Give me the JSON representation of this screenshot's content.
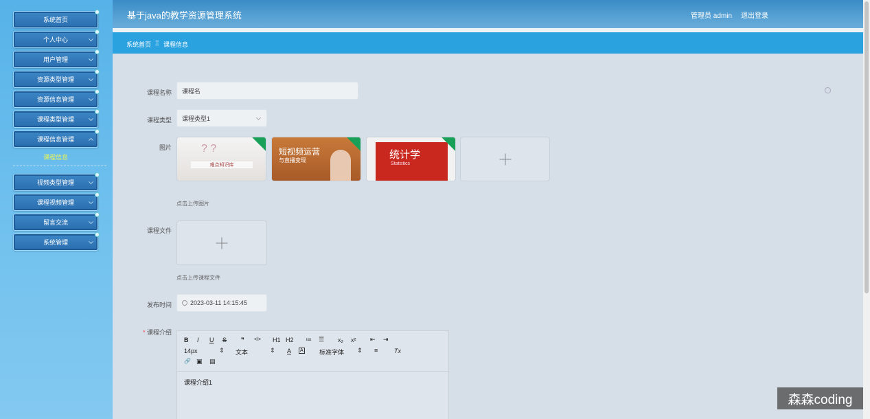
{
  "app": {
    "title": "基于java的教学资源管理系统",
    "user_label": "管理员 admin",
    "logout_label": "退出登录"
  },
  "sidebar": {
    "items": [
      {
        "label": "系统首页"
      },
      {
        "label": "个人中心"
      },
      {
        "label": "用户管理"
      },
      {
        "label": "资源类型管理"
      },
      {
        "label": "资源信息管理"
      },
      {
        "label": "课程类型管理"
      },
      {
        "label": "课程信息管理"
      },
      {
        "label": "视频类型管理"
      },
      {
        "label": "课程视频管理"
      },
      {
        "label": "留言交流"
      },
      {
        "label": "系统管理"
      }
    ],
    "active_sub_item": "课程信息"
  },
  "breadcrumb": {
    "home": "系统首页",
    "separator": "Ξ",
    "current": "课程信息"
  },
  "form": {
    "course_name_label": "课程名称",
    "course_name_value": "课程名",
    "course_type_label": "课程类型",
    "course_type_value": "课程类型1",
    "image_label": "图片",
    "image_hint": "点击上传图片",
    "images": [
      {
        "caption": "难点知识库"
      },
      {
        "title": "短视频运营",
        "subtitle": "与直播变现"
      },
      {
        "title": "统计学",
        "subtitle": "Statistics"
      }
    ],
    "file_label": "课程文件",
    "file_hint": "点击上传课程文件",
    "publish_time_label": "发布时间",
    "publish_time_value": "2023-03-11 14:15:45",
    "intro_required_mark": "*",
    "intro_label": "课程介绍",
    "intro_content": "课程介绍1"
  },
  "editor": {
    "font_size": "14px",
    "text_type": "文本",
    "font_family": "标准字体",
    "buttons": [
      "B",
      "I",
      "U",
      "S",
      "❞",
      "</>",
      "H1",
      "H2",
      "≔",
      "☰",
      "x₂",
      "x²",
      "⇤",
      "⇥",
      "A",
      "A",
      "≡",
      "Tx",
      "🔗",
      "▣",
      "▤"
    ]
  },
  "watermark": "森森coding",
  "colors": {
    "sidebar": "#56b2e8",
    "header": "#3a8cc6",
    "breadcrumb_bar": "#2aa2e0",
    "active_sub_item": "#e6f25a"
  }
}
